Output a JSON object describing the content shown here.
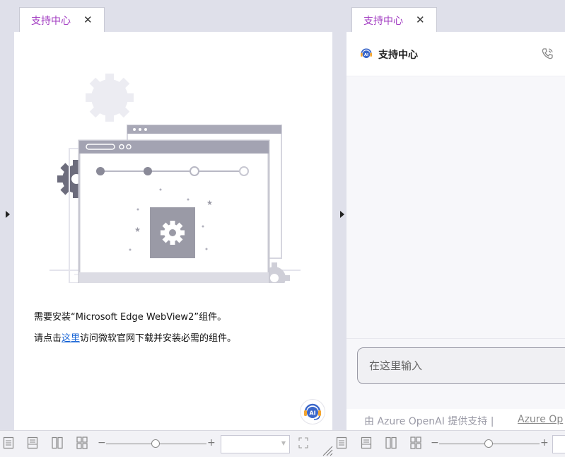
{
  "left_tab": {
    "label": "支持中心",
    "close": "✕"
  },
  "right_tab": {
    "label": "支持中心",
    "close": "✕"
  },
  "message": {
    "line1": "需要安装“Microsoft Edge WebView2”组件。",
    "line2_prefix": "请点击",
    "line2_link": "这里",
    "line2_suffix": "访问微软官网下载并安装必需的组件。"
  },
  "chat": {
    "title": "支持中心",
    "input_placeholder": "在这里输入",
    "footer_text": "由 Azure OpenAI 提供支持 | ",
    "footer_link": "Azure Op"
  },
  "status": {
    "zoom_minus": "−",
    "zoom_plus": "+"
  },
  "colors": {
    "accent": "#a23cc2",
    "link": "#1a66d6",
    "ai_blue": "#3a66c9",
    "ai_orange": "#f4a530"
  },
  "icons": [
    "close-icon",
    "collapse-arrow-icon",
    "headset-ai-icon",
    "phone-icon",
    "view-mode-icon",
    "zoom-slider",
    "fullscreen-icon",
    "resize-grip-icon"
  ]
}
